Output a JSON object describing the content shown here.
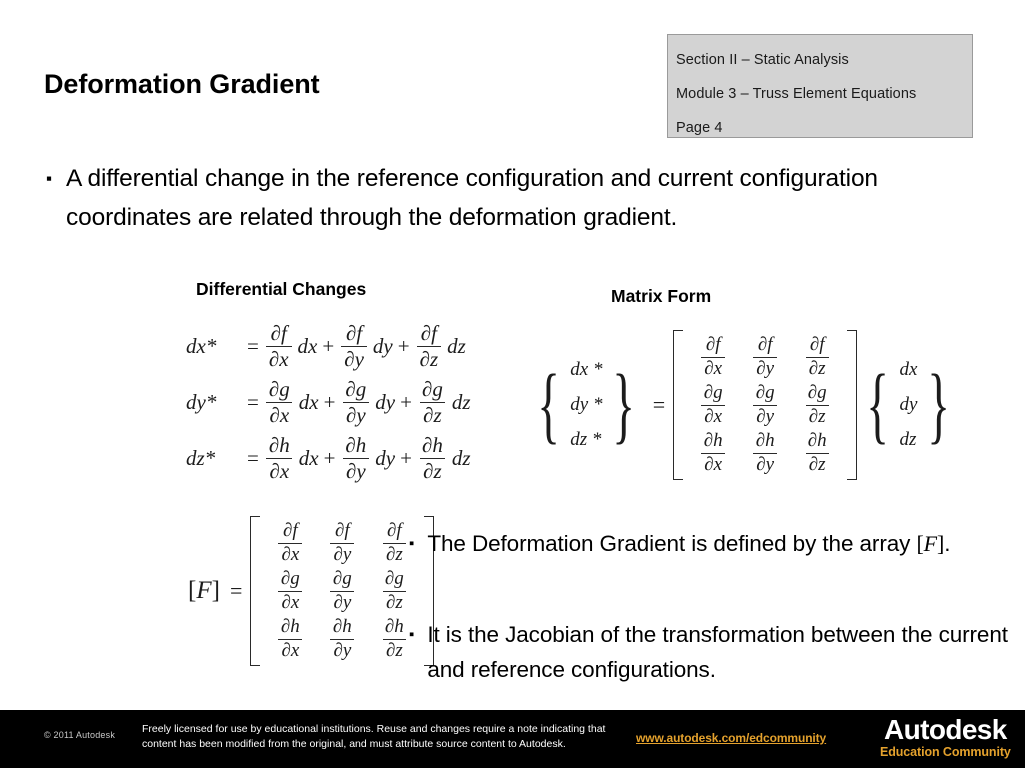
{
  "header_box": {
    "lines": [
      "Section II – Static Analysis",
      "Module 3 – Truss Element Equations",
      "Page 4"
    ]
  },
  "slide": {
    "title": "Deformation Gradient",
    "bullet_marker": "▪",
    "main_bullet": "A differential change in the reference configuration and current configuration coordinates are related through the deformation gradient."
  },
  "sections": {
    "differential_heading": "Differential Changes",
    "matrix_heading": "Matrix Form"
  },
  "differential_equations": [
    {
      "lhs": "dx*",
      "equals": "=",
      "terms": [
        {
          "num": "∂f",
          "den": "∂x",
          "var": "dx",
          "op": "+"
        },
        {
          "num": "∂f",
          "den": "∂y",
          "var": "dy",
          "op": "+"
        },
        {
          "num": "∂f",
          "den": "∂z",
          "var": "dz",
          "op": ""
        }
      ]
    },
    {
      "lhs": "dy*",
      "equals": "=",
      "terms": [
        {
          "num": "∂g",
          "den": "∂x",
          "var": "dx",
          "op": "+"
        },
        {
          "num": "∂g",
          "den": "∂y",
          "var": "dy",
          "op": "+"
        },
        {
          "num": "∂g",
          "den": "∂z",
          "var": "dz",
          "op": ""
        }
      ]
    },
    {
      "lhs": "dz*",
      "equals": "=",
      "terms": [
        {
          "num": "∂h",
          "den": "∂x",
          "var": "dx",
          "op": "+"
        },
        {
          "num": "∂h",
          "den": "∂y",
          "var": "dy",
          "op": "+"
        },
        {
          "num": "∂h",
          "den": "∂z",
          "var": "dz",
          "op": ""
        }
      ]
    }
  ],
  "matrix_equation": {
    "lhs_vector": [
      "dx *",
      "dy *",
      "dz *"
    ],
    "equals": "=",
    "matrix": [
      [
        {
          "num": "∂f",
          "den": "∂x"
        },
        {
          "num": "∂f",
          "den": "∂y"
        },
        {
          "num": "∂f",
          "den": "∂z"
        }
      ],
      [
        {
          "num": "∂g",
          "den": "∂x"
        },
        {
          "num": "∂g",
          "den": "∂y"
        },
        {
          "num": "∂g",
          "den": "∂z"
        }
      ],
      [
        {
          "num": "∂h",
          "den": "∂x"
        },
        {
          "num": "∂h",
          "den": "∂y"
        },
        {
          "num": "∂h",
          "den": "∂z"
        }
      ]
    ],
    "rhs_vector": [
      "dx",
      "dy",
      "dz"
    ],
    "brace_left": "{",
    "brace_right": "}"
  },
  "f_definition": {
    "label_open": "[",
    "label_symbol": "F",
    "label_close": "]",
    "equals": "=",
    "matrix": [
      [
        {
          "num": "∂f",
          "den": "∂x"
        },
        {
          "num": "∂f",
          "den": "∂y"
        },
        {
          "num": "∂f",
          "den": "∂z"
        }
      ],
      [
        {
          "num": "∂g",
          "den": "∂x"
        },
        {
          "num": "∂g",
          "den": "∂y"
        },
        {
          "num": "∂g",
          "den": "∂z"
        }
      ],
      [
        {
          "num": "∂h",
          "den": "∂x"
        },
        {
          "num": "∂h",
          "den": "∂y"
        },
        {
          "num": "∂h",
          "den": "∂z"
        }
      ]
    ]
  },
  "sub_bullets": [
    {
      "text_before": "The Deformation Gradient is defined by the array ",
      "math": "[F]",
      "text_after": "."
    },
    {
      "text_before": "It is the Jacobian of the transformation between the current and reference configurations.",
      "math": "",
      "text_after": ""
    }
  ],
  "footer": {
    "copyright": "© 2011 Autodesk",
    "license": "Freely licensed for use by educational institutions. Reuse and changes require a note indicating that content has been modified from the original, and must attribute source content to Autodesk.",
    "url": "www.autodesk.com/edcommunity",
    "brand": "Autodesk",
    "tagline": "Education Community"
  },
  "colors": {
    "header_box_bg": "#D3D3D3",
    "footer_bg": "#000000",
    "accent_gold": "#E5A22D",
    "text": "#000000"
  }
}
